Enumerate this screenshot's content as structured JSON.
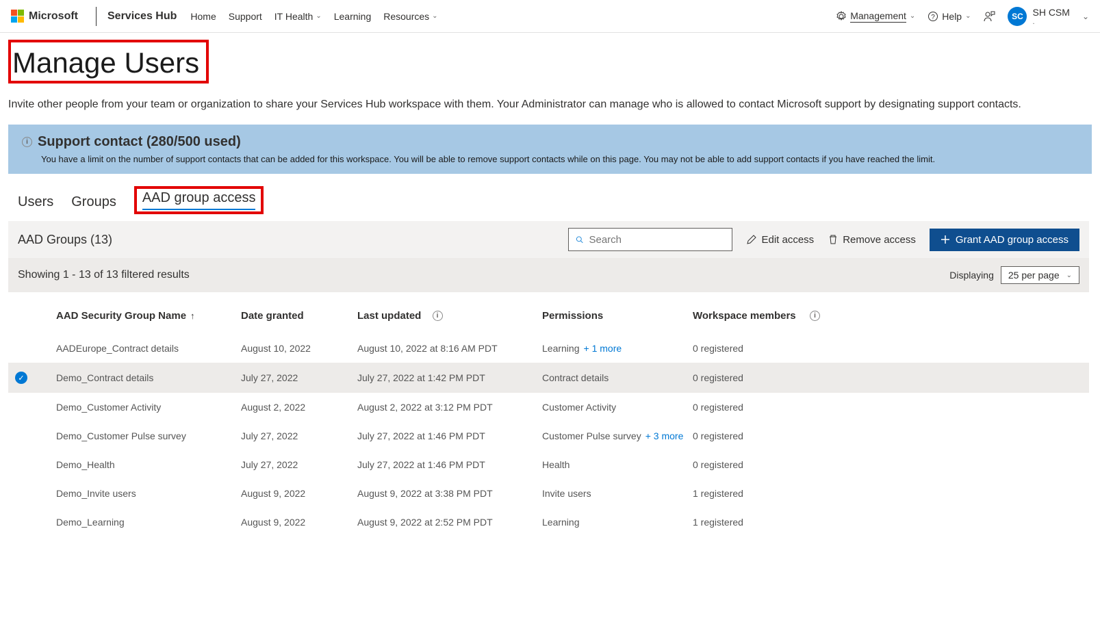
{
  "header": {
    "brand": "Microsoft",
    "hub": "Services Hub",
    "nav": [
      "Home",
      "Support",
      "IT Health",
      "Learning",
      "Resources"
    ],
    "management": "Management",
    "help": "Help",
    "user_initials": "SC",
    "user_name": "SH CSM",
    "user_sub": "."
  },
  "page": {
    "title": "Manage Users",
    "subtitle": "Invite other people from your team or organization to share your Services Hub workspace with them. Your Administrator can manage who is allowed to contact Microsoft support by designating support contacts."
  },
  "banner": {
    "title": "Support contact (280/500 used)",
    "text": "You have a limit on the number of support contacts that can be added for this workspace. You will be able to remove support contacts while on this page. You may not be able to add support contacts if you have reached the limit."
  },
  "tabs": {
    "users": "Users",
    "groups": "Groups",
    "aad": "AAD group access"
  },
  "toolbar": {
    "heading": "AAD Groups (13)",
    "search_placeholder": "Search",
    "edit": "Edit access",
    "remove": "Remove access",
    "grant": "Grant AAD group access"
  },
  "filter": {
    "showing": "Showing 1 - 13 of 13 filtered results",
    "displaying": "Displaying",
    "per_page": "25 per page"
  },
  "columns": {
    "name": "AAD Security Group Name",
    "date": "Date granted",
    "updated": "Last updated",
    "perms": "Permissions",
    "members": "Workspace members"
  },
  "rows": [
    {
      "selected": false,
      "name": "AADEurope_Contract details",
      "date": "August 10, 2022",
      "updated": "August 10, 2022 at 8:16 AM PDT",
      "perms": "Learning",
      "more": "+ 1 more",
      "members": "0 registered"
    },
    {
      "selected": true,
      "name": "Demo_Contract details",
      "date": "July 27, 2022",
      "updated": "July 27, 2022 at 1:42 PM PDT",
      "perms": "Contract details",
      "more": "",
      "members": "0 registered"
    },
    {
      "selected": false,
      "name": "Demo_Customer Activity",
      "date": "August 2, 2022",
      "updated": "August 2, 2022 at 3:12 PM PDT",
      "perms": "Customer Activity",
      "more": "",
      "members": "0 registered"
    },
    {
      "selected": false,
      "name": "Demo_Customer Pulse survey",
      "date": "July 27, 2022",
      "updated": "July 27, 2022 at 1:46 PM PDT",
      "perms": "Customer Pulse survey",
      "more": "+ 3 more",
      "members": "0 registered"
    },
    {
      "selected": false,
      "name": "Demo_Health",
      "date": "July 27, 2022",
      "updated": "July 27, 2022 at 1:46 PM PDT",
      "perms": "Health",
      "more": "",
      "members": "0 registered"
    },
    {
      "selected": false,
      "name": "Demo_Invite users",
      "date": "August 9, 2022",
      "updated": "August 9, 2022 at 3:38 PM PDT",
      "perms": "Invite users",
      "more": "",
      "members": "1 registered"
    },
    {
      "selected": false,
      "name": "Demo_Learning",
      "date": "August 9, 2022",
      "updated": "August 9, 2022 at 2:52 PM PDT",
      "perms": "Learning",
      "more": "",
      "members": "1 registered"
    }
  ]
}
